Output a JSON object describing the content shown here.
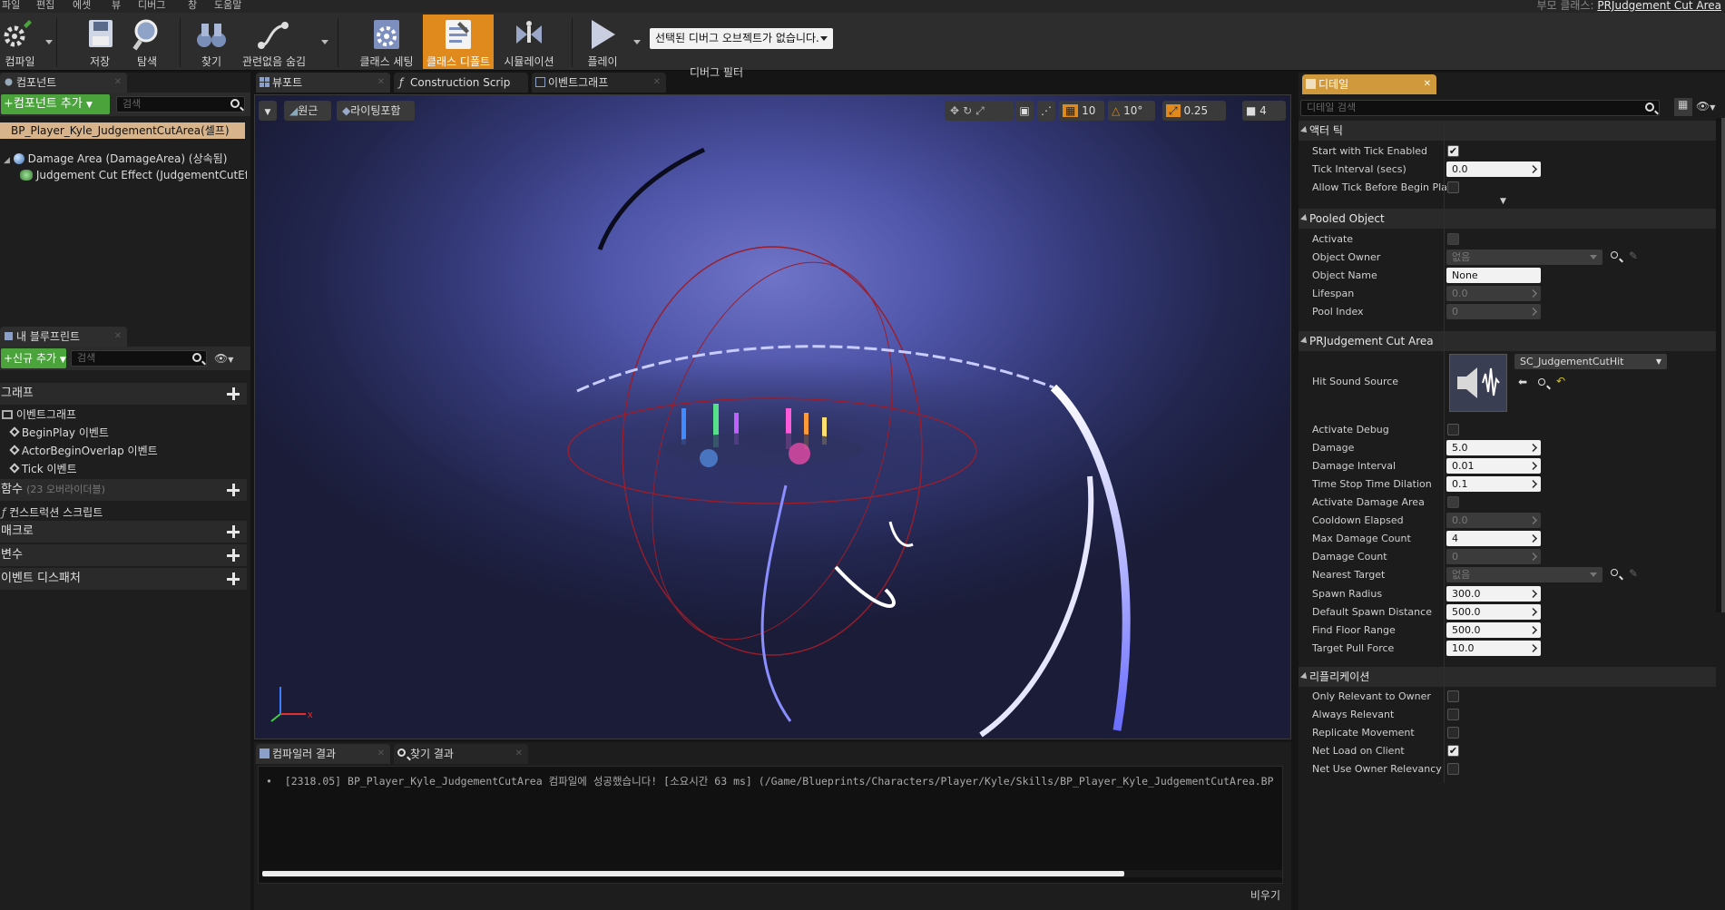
{
  "menu": {
    "items": [
      "파일",
      "편집",
      "에셋",
      "뷰",
      "디버그",
      "창",
      "도움말"
    ],
    "parent_class_label": "부모 클래스:",
    "parent_class": "PRJudgement Cut Area"
  },
  "toolbar": {
    "compile": "컴파일",
    "save": "저장",
    "browse": "탐색",
    "find": "찾기",
    "hide_unrelated": "관련없음 숨김",
    "class_settings": "클래스 세팅",
    "class_defaults": "클래스 디폴트",
    "simulation": "시뮬레이션",
    "play": "플레이",
    "debug_object": "선택된 디버그 오브젝트가 없습니다.",
    "debug_filter": "디버그 필터"
  },
  "components": {
    "tab": "컴포넌트",
    "add_button": "+컴포넌트 추가",
    "search_placeholder": "검색",
    "self": "BP_Player_Kyle_JudgementCutArea(셀프)",
    "items": [
      "Damage Area (DamageArea) (상속됨)",
      "Judgement Cut Effect (JudgementCutEffec"
    ]
  },
  "my_blueprint": {
    "tab": "내 블루프린트",
    "add_new": "+신규 추가",
    "search_placeholder": "검색",
    "graphs_section": "그래프",
    "event_graph": "이벤트그래프",
    "events": [
      "BeginPlay 이벤트",
      "ActorBeginOverlap 이벤트",
      "Tick 이벤트"
    ],
    "functions_section": "함수",
    "functions_note": "(23 오버라이더블)",
    "construction_script": "컨스트럭션 스크립트",
    "macros_section": "매크로",
    "variables_section": "변수",
    "dispatchers_section": "이벤트 디스패처"
  },
  "editor_tabs": [
    "뷰포트",
    "Construction Scrip",
    "이벤트그래프"
  ],
  "viewport": {
    "perspective": "원근",
    "lighting": "라이팅포함",
    "grid_snap": "10",
    "rot_snap": "10°",
    "scale_snap": "0.25",
    "cam_speed": "4"
  },
  "output": {
    "tabs": [
      "컴파일러 결과",
      "찾기 결과"
    ],
    "log_line": "[2318.05] BP_Player_Kyle_JudgementCutArea 컴파일에 성공했습니다! [소요시간 63 ms] (/Game/Blueprints/Characters/Player/Kyle/Skills/BP_Player_Kyle_JudgementCutArea.BP",
    "clear": "비우기"
  },
  "details": {
    "tab": "디테일",
    "search_placeholder": "디테일 검색",
    "actor_tick": {
      "title": "액터 틱",
      "start_with_tick_label": "Start with Tick Enabled",
      "start_with_tick": true,
      "tick_interval_label": "Tick Interval (secs)",
      "tick_interval": "0.0",
      "allow_tick_label": "Allow Tick Before Begin Play",
      "allow_tick": false
    },
    "pooled": {
      "title": "Pooled Object",
      "activate_label": "Activate",
      "owner_label": "Object Owner",
      "owner": "없음",
      "name_label": "Object Name",
      "name": "None",
      "lifespan_label": "Lifespan",
      "lifespan": "0.0",
      "pool_index_label": "Pool Index",
      "pool_index": "0"
    },
    "area": {
      "title": "PRJudgement Cut Area",
      "hit_sound_label": "Hit Sound Source",
      "hit_sound": "SC_JudgementCutHit",
      "activate_debug_label": "Activate Debug",
      "damage_label": "Damage",
      "damage": "5.0",
      "damage_interval_label": "Damage Interval",
      "damage_interval": "0.01",
      "time_stop_label": "Time Stop Time Dilation",
      "time_stop": "0.1",
      "activate_area_label": "Activate Damage Area",
      "cooldown_label": "Cooldown Elapsed",
      "cooldown": "0.0",
      "max_count_label": "Max Damage Count",
      "max_count": "4",
      "count_label": "Damage Count",
      "count": "0",
      "nearest_label": "Nearest Target",
      "nearest": "없음",
      "spawn_radius_label": "Spawn Radius",
      "spawn_radius": "300.0",
      "spawn_distance_label": "Default Spawn Distance",
      "spawn_distance": "500.0",
      "floor_range_label": "Find Floor Range",
      "floor_range": "500.0",
      "pull_force_label": "Target Pull Force",
      "pull_force": "10.0"
    },
    "replication": {
      "title": "리플리케이션",
      "only_owner_label": "Only Relevant to Owner",
      "always_label": "Always Relevant",
      "replicate_movement_label": "Replicate Movement",
      "net_load_label": "Net Load on Client",
      "net_owner_label": "Net Use Owner Relevancy"
    }
  },
  "colors": {
    "accent": "#e08a1e",
    "green": "#4aa43b",
    "selection": "#d7b48b"
  }
}
